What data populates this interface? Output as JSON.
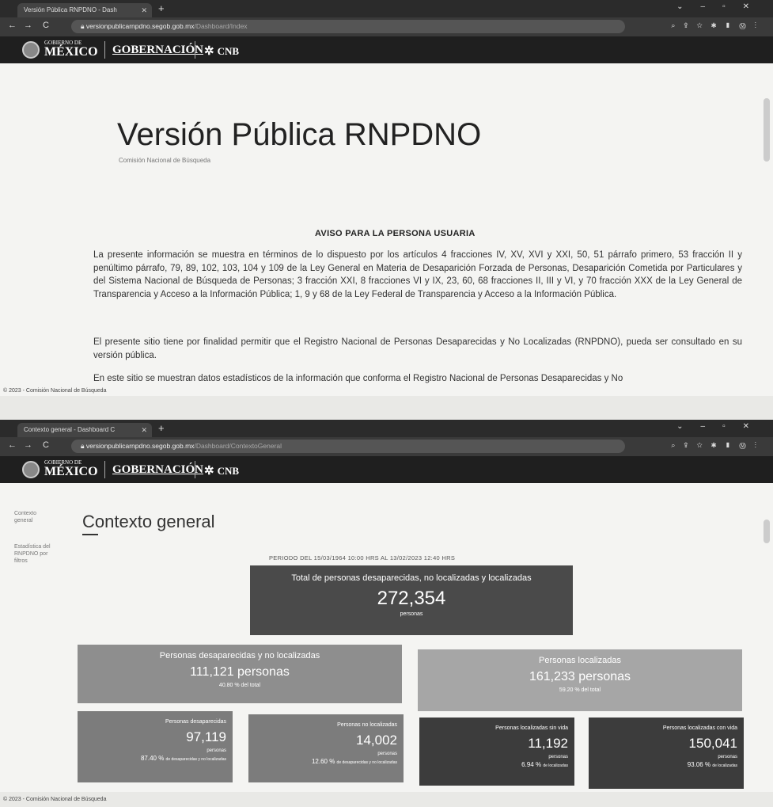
{
  "screen1": {
    "tab_title": "Versión Pública RNPDNO - Dash",
    "url_host": "versionpublicarnpdno.segob.gob.mx",
    "url_path": "/Dashboard/Index",
    "page_title": "Versión Pública RNPDNO",
    "page_subtitle": "Comisión Nacional de Búsqueda",
    "aviso_heading": "AVISO PARA LA PERSONA USUARIA",
    "paragraph1": "La presente información se muestra en términos de lo dispuesto por los artículos 4 fracciones IV, XV, XVI y XXI, 50, 51 párrafo primero, 53 fracción II y penúltimo párrafo, 79, 89, 102, 103, 104 y 109 de la Ley General en Materia de Desaparición Forzada de Personas, Desaparición Cometida por Particulares y del Sistema Nacional de Búsqueda de Personas; 3 fracción XXI, 8 fracciones VI y IX, 23, 60, 68 fracciones II, III y VI, y 70 fracción XXX de la Ley General de Transparencia y Acceso a la Información Pública; 1, 9 y 68 de la Ley Federal de Transparencia y Acceso a la Información Pública.",
    "paragraph2": "El presente sitio tiene por finalidad permitir que el Registro Nacional de Personas Desaparecidas y No Localizadas (RNPDNO), pueda ser consultado en su versión pública.",
    "paragraph3": "En este sitio se muestran datos estadísticos de la información que conforma el Registro Nacional de Personas Desaparecidas y No",
    "footer": "© 2023 - Comisión Nacional de Búsqueda"
  },
  "screen2": {
    "tab_title": "Contexto general - Dashboard C",
    "url_host": "versionpublicarnpdno.segob.gob.mx",
    "url_path": "/Dashboard/ContextoGeneral",
    "sidebar": [
      "Contexto general",
      "Estadística del RNPDNO por filtros"
    ],
    "title": "Contexto general",
    "periodo": "PERIODO DEL 15/03/1964 10:00 HRS AL 13/02/2023 12:40 HRS",
    "total": {
      "label": "Total de personas desaparecidas, no localizadas y localizadas",
      "value": "272,354",
      "unit": "personas"
    },
    "desap": {
      "label": "Personas desaparecidas y no localizadas",
      "value": "111,121 personas",
      "pct": "40.80 % del total"
    },
    "local": {
      "label": "Personas localizadas",
      "value": "161,233 personas",
      "pct": "59.20 % del total"
    },
    "d1": {
      "label": "Personas desaparecidas",
      "value": "97,119",
      "unit": "personas",
      "pct": "87.40 %",
      "pct_desc": "de desaparecidas y no localizadas"
    },
    "d2": {
      "label": "Personas no localizadas",
      "value": "14,002",
      "unit": "personas",
      "pct": "12.60 %",
      "pct_desc": "de desaparecidas y no localizadas"
    },
    "l1": {
      "label": "Personas localizadas sin vida",
      "value": "11,192",
      "unit": "personas",
      "pct": "6.94 %",
      "pct_desc": "de localizadas"
    },
    "l2": {
      "label": "Personas localizadas con vida",
      "value": "150,041",
      "unit": "personas",
      "pct": "93.06 %",
      "pct_desc": "de localizadas"
    },
    "footer": "© 2023 - Comisión Nacional de Búsqueda"
  },
  "header": {
    "gob_small": "GOBIERNO DE",
    "gob_big": "MÉXICO",
    "gobernacion": "GOBERNACIÓN",
    "cnb": "CNB"
  },
  "colors": {
    "total_card": "#4a4a4a",
    "desap_card": "#8e8e8e",
    "local_card": "#a6a6a6",
    "d_small": "#7c7c7c",
    "l_small": "#3c3c3c"
  }
}
